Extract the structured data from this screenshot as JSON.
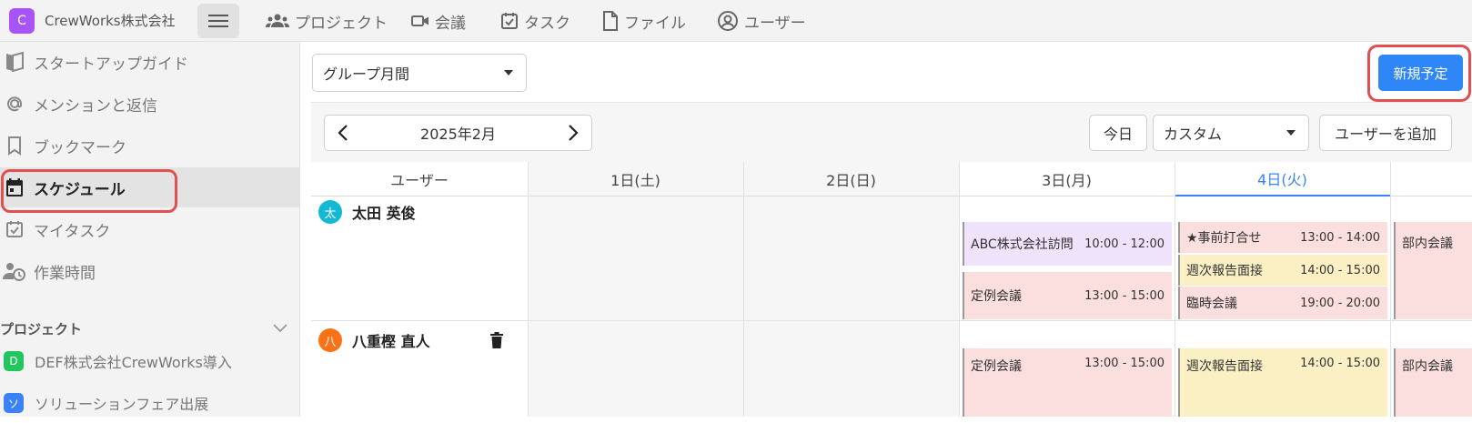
{
  "app": {
    "logo_letter": "C",
    "company": "CrewWorks株式会社"
  },
  "topnav": [
    {
      "label": "プロジェクト",
      "icon": "people-icon"
    },
    {
      "label": "会議",
      "icon": "video-camera-icon"
    },
    {
      "label": "タスク",
      "icon": "task-check-icon"
    },
    {
      "label": "ファイル",
      "icon": "file-icon"
    },
    {
      "label": "ユーザー",
      "icon": "user-circle-icon"
    }
  ],
  "sidebar": {
    "items": [
      {
        "label": "スタートアップガイド",
        "icon": "map-icon"
      },
      {
        "label": "メンションと返信",
        "icon": "at-icon"
      },
      {
        "label": "ブックマーク",
        "icon": "bookmark-icon"
      },
      {
        "label": "スケジュール",
        "icon": "calendar-icon",
        "active": true
      },
      {
        "label": "マイタスク",
        "icon": "task-check-icon"
      },
      {
        "label": "作業時間",
        "icon": "user-clock-icon"
      }
    ],
    "section_label": "プロジェクト",
    "projects": [
      {
        "badge": "D",
        "label": "DEF株式会社CrewWorks導入",
        "color": "#22c55e"
      },
      {
        "badge": "ソ",
        "label": "ソリューションフェア出展",
        "color": "#3b82f6"
      }
    ]
  },
  "view_select": {
    "value": "グループ月間"
  },
  "new_button": "新規予定",
  "toolbar": {
    "month": "2025年2月",
    "today": "今日",
    "range_select": "カスタム",
    "add_user": "ユーザーを追加"
  },
  "columns": {
    "user_header": "ユーザー",
    "days": [
      {
        "label": "1日(土)",
        "weekend": true
      },
      {
        "label": "2日(日)",
        "weekend": true
      },
      {
        "label": "3日(月)",
        "weekend": false
      },
      {
        "label": "4日(火)",
        "weekend": false,
        "today": true
      }
    ]
  },
  "users": [
    {
      "avatar": "太",
      "avatar_color": "#14b8d4",
      "name": "太田 英俊",
      "events": {
        "d3": [
          {
            "title": "ABC株式会社訪問",
            "time": "10:00 - 12:00",
            "color": "purple"
          },
          {
            "title": "定例会議",
            "time": "13:00 - 15:00",
            "color": "pink"
          }
        ],
        "d4": [
          {
            "title": "★事前打合せ",
            "time": "13:00 - 14:00",
            "color": "pink"
          },
          {
            "title": "週次報告面接",
            "time": "14:00 - 15:00",
            "color": "yellow"
          },
          {
            "title": "臨時会議",
            "time": "19:00 - 20:00",
            "color": "pink"
          }
        ],
        "d5": [
          {
            "title": "部内会議",
            "color": "pink"
          }
        ]
      }
    },
    {
      "avatar": "八",
      "avatar_color": "#f97316",
      "name": "八重樫 直人",
      "trash_icon": "trash-icon",
      "events": {
        "d3": [
          {
            "title": "定例会議",
            "time": "13:00 - 15:00",
            "color": "pink"
          }
        ],
        "d4": [
          {
            "title": "週次報告面接",
            "time": "14:00 - 15:00",
            "color": "yellow"
          }
        ],
        "d5": [
          {
            "title": "部内会議",
            "color": "pink"
          }
        ]
      }
    }
  ]
}
